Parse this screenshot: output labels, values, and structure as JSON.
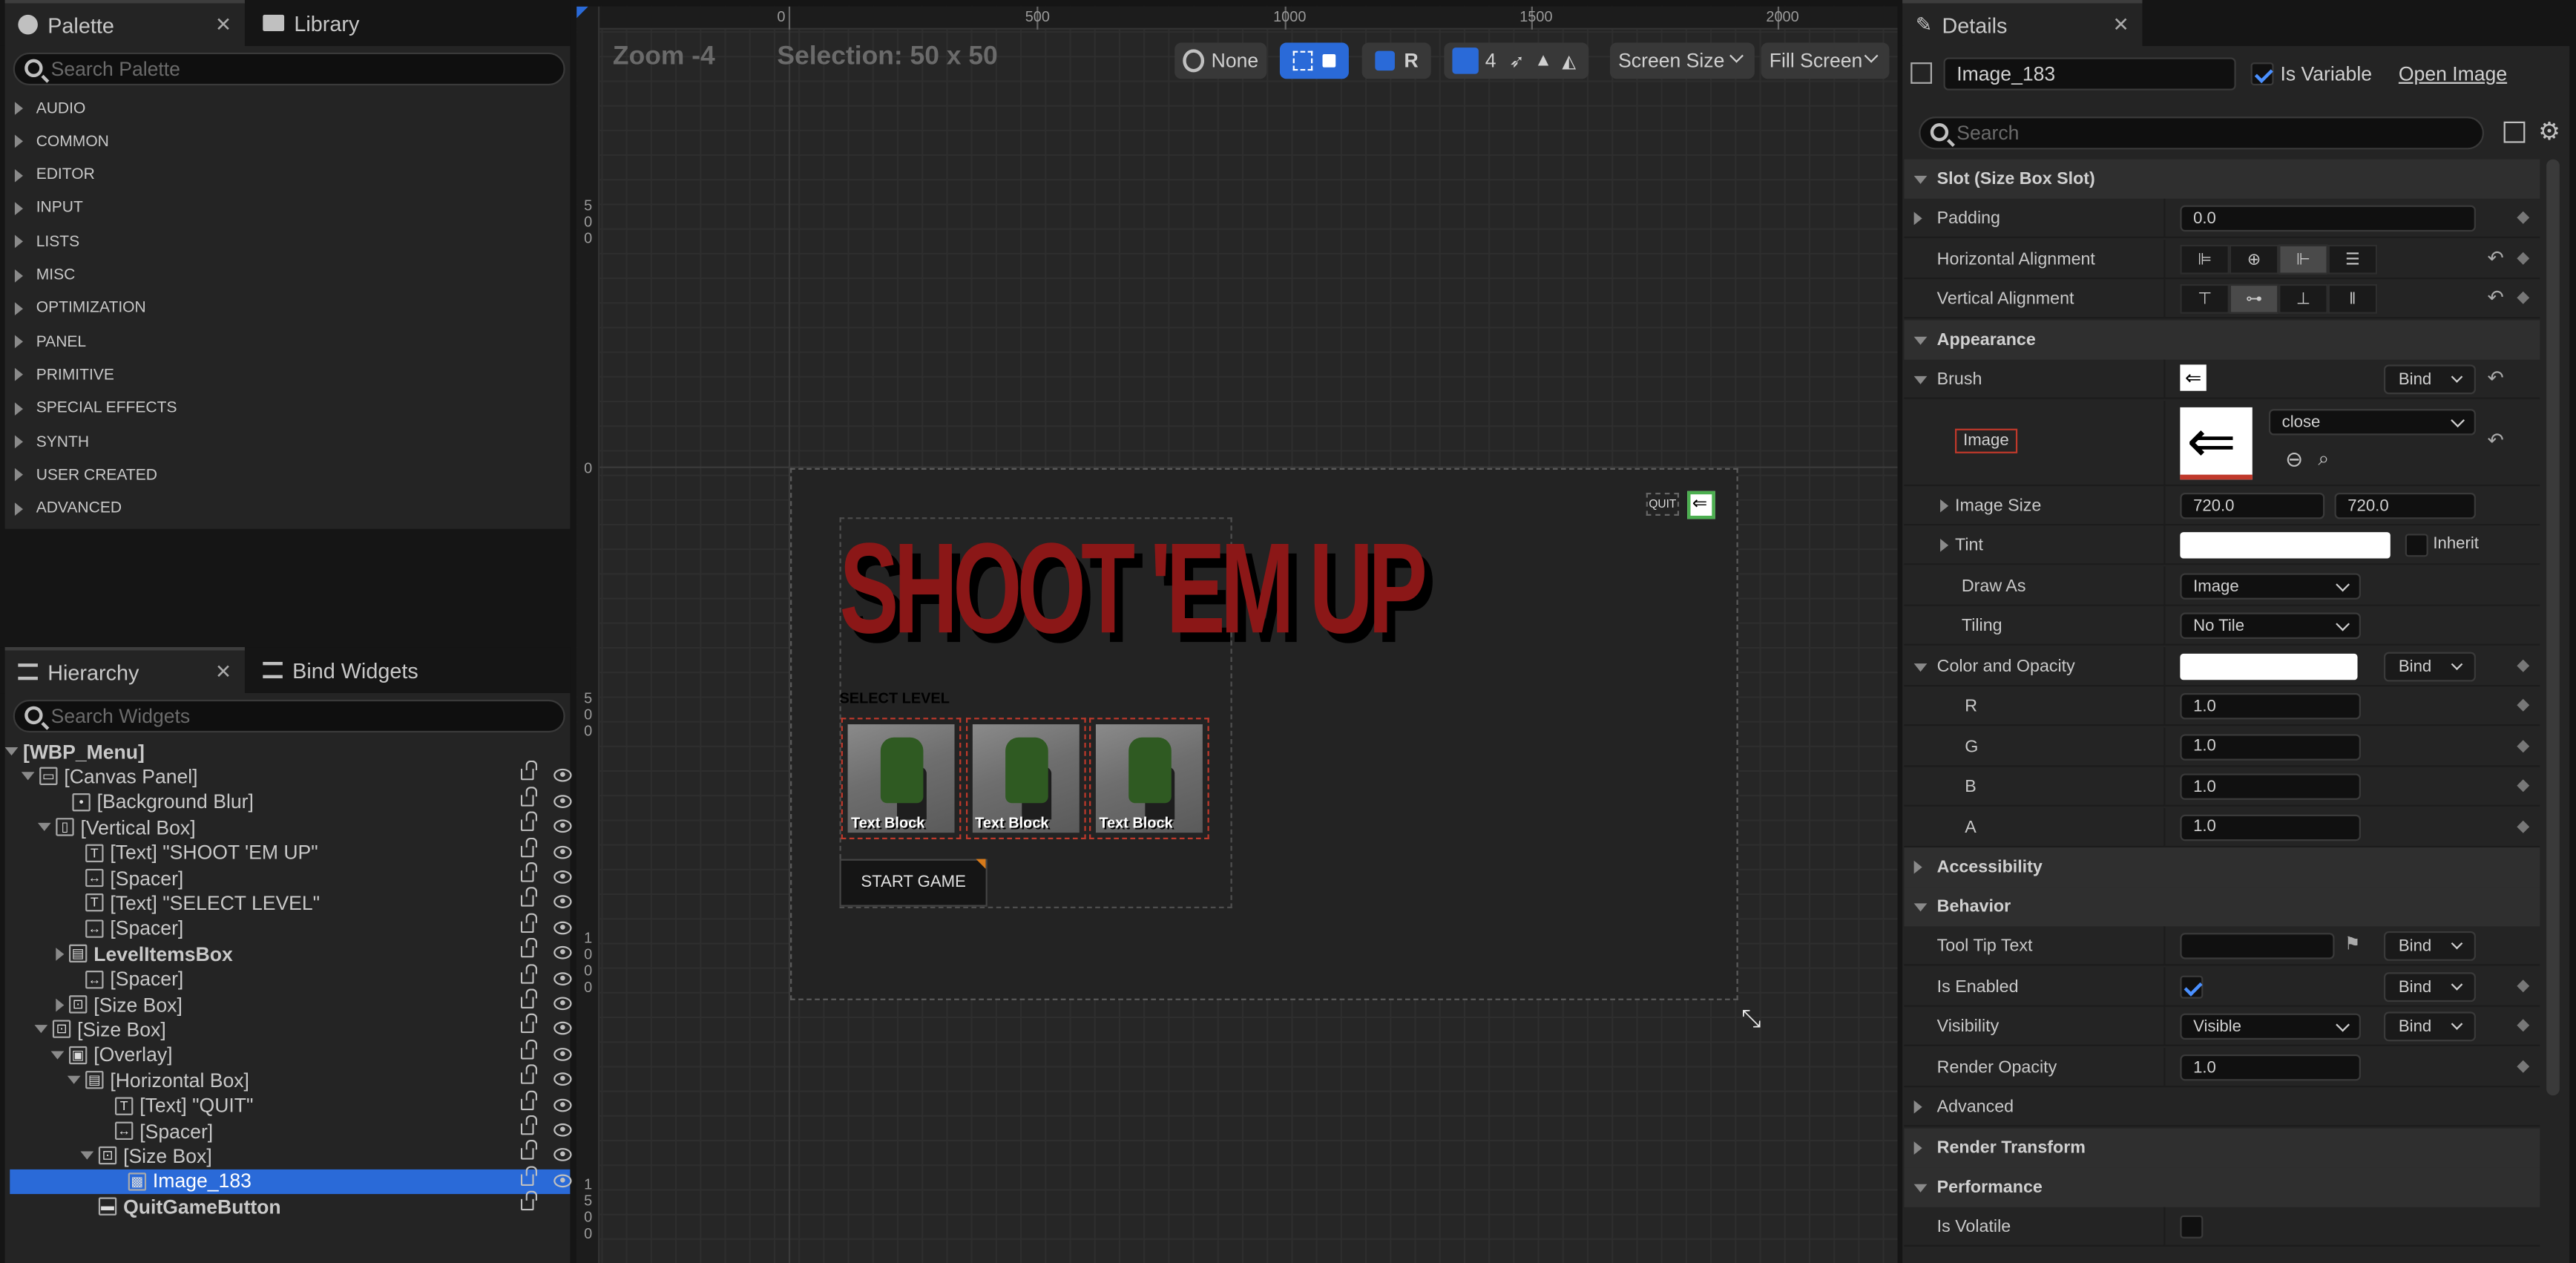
{
  "palette": {
    "tab_label": "Palette",
    "library_tab_label": "Library",
    "search_placeholder": "Search Palette",
    "categories": [
      "AUDIO",
      "COMMON",
      "EDITOR",
      "INPUT",
      "LISTS",
      "MISC",
      "OPTIMIZATION",
      "PANEL",
      "PRIMITIVE",
      "SPECIAL EFFECTS",
      "SYNTH",
      "USER CREATED",
      "ADVANCED"
    ]
  },
  "hierarchy": {
    "tab_label": "Hierarchy",
    "bind_tab_label": "Bind Widgets",
    "search_placeholder": "Search Widgets",
    "items": [
      {
        "label": "[WBP_Menu]",
        "icon": ""
      },
      {
        "label": "[Canvas Panel]",
        "icon": "canvas-icon"
      },
      {
        "label": "[Background Blur]",
        "icon": "dot-icon"
      },
      {
        "label": "[Vertical Box]",
        "icon": "vbox-icon"
      },
      {
        "label": "[Text] \"SHOOT 'EM UP\"",
        "icon": "text-icon"
      },
      {
        "label": "[Spacer]",
        "icon": "spacer-icon"
      },
      {
        "label": "[Text] \"SELECT LEVEL\"",
        "icon": "text-icon"
      },
      {
        "label": "[Spacer]",
        "icon": "spacer-icon"
      },
      {
        "label": "LevelItemsBox",
        "icon": "hbox-icon"
      },
      {
        "label": "[Spacer]",
        "icon": "spacer-icon"
      },
      {
        "label": "[Size Box]",
        "icon": "sizebox-icon"
      },
      {
        "label": "[Size Box]",
        "icon": "sizebox-icon"
      },
      {
        "label": "[Overlay]",
        "icon": "overlay-icon"
      },
      {
        "label": "[Horizontal Box]",
        "icon": "hbox-icon"
      },
      {
        "label": "[Text] \"QUIT\"",
        "icon": "text-icon"
      },
      {
        "label": "[Spacer]",
        "icon": "spacer-icon"
      },
      {
        "label": "[Size Box]",
        "icon": "sizebox-icon"
      },
      {
        "label": "Image_183",
        "icon": "image-icon"
      },
      {
        "label": "QuitGameButton",
        "icon": "button-icon"
      }
    ]
  },
  "designer": {
    "zoom": "Zoom -4",
    "selection": "Selection: 50 x 50",
    "toolbar": {
      "locale": "None",
      "r_label": "R",
      "grid_snap": "4",
      "screen_size": "Screen Size",
      "fill_screen": "Fill Screen"
    },
    "ruler_top": [
      "0",
      "500",
      "1000",
      "1500",
      "2000"
    ],
    "ruler_left": [
      "500",
      "0",
      "500",
      "1000",
      "1500"
    ],
    "canvas": {
      "title": "SHOOT 'EM UP",
      "select_level": "SELECT LEVEL",
      "level_items": [
        "Text Block",
        "Text Block",
        "Text Block"
      ],
      "start_button": "START GAME",
      "quit_label": "QUIT"
    }
  },
  "details": {
    "tab_label": "Details",
    "widget_name": "Image_183",
    "is_variable_label": "Is Variable",
    "is_variable": true,
    "open_image_label": "Open Image",
    "search_placeholder": "Search",
    "slot_section": "Slot (Size Box Slot)",
    "padding_label": "Padding",
    "padding_value": "0.0",
    "h_align_label": "Horizontal Alignment",
    "v_align_label": "Vertical Alignment",
    "appearance_section": "Appearance",
    "brush_label": "Brush",
    "bind_label": "Bind",
    "image_label": "Image",
    "image_asset": "close",
    "image_size_label": "Image Size",
    "image_size_x": "720.0",
    "image_size_y": "720.0",
    "tint_label": "Tint",
    "inherit_label": "Inherit",
    "draw_as_label": "Draw As",
    "draw_as_value": "Image",
    "tiling_label": "Tiling",
    "tiling_value": "No Tile",
    "color_opacity_section": "Color and Opacity",
    "r_label": "R",
    "r_value": "1.0",
    "g_label": "G",
    "g_value": "1.0",
    "b_label": "B",
    "b_value": "1.0",
    "a_label": "A",
    "a_value": "1.0",
    "accessibility_section": "Accessibility",
    "behavior_section": "Behavior",
    "tooltip_label": "Tool Tip Text",
    "is_enabled_label": "Is Enabled",
    "is_enabled": true,
    "visibility_label": "Visibility",
    "visibility_value": "Visible",
    "render_opacity_label": "Render Opacity",
    "render_opacity_value": "1.0",
    "advanced_section": "Advanced",
    "render_transform_section": "Render Transform",
    "performance_section": "Performance",
    "is_volatile_label": "Is Volatile"
  },
  "colors": {
    "accent_blue": "#2a6ad8",
    "title_red": "#8b1717",
    "panel_bg": "#242424"
  }
}
